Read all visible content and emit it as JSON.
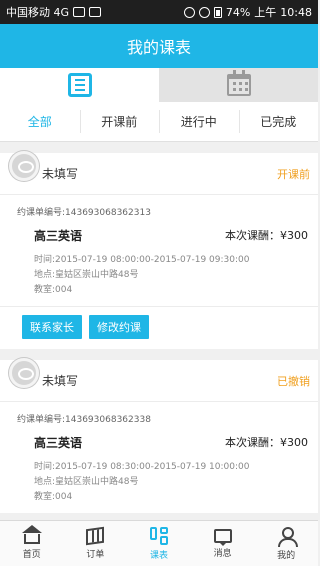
{
  "statusbar": {
    "carrier": "中国移动 4G",
    "battery": "74%",
    "time_prefix": "上午",
    "time": "10:48"
  },
  "header": {
    "title": "我的课表"
  },
  "view_tabs": [
    {
      "name": "list-view",
      "icon": "list-icon",
      "active": true
    },
    {
      "name": "calendar-view",
      "icon": "calendar-icon",
      "active": false
    }
  ],
  "filters": [
    "全部",
    "开课前",
    "进行中",
    "已完成"
  ],
  "orders": [
    {
      "name": "未填写",
      "status": "开课前",
      "order_no": "约课单编号:143693068362313",
      "course": "高三英语",
      "fee": "本次课酬：¥300",
      "time": "时间:2015-07-19 08:00:00-2015-07-19 09:30:00",
      "address": "地点:皇姑区崇山中路48号",
      "room": "教室:004",
      "buttons": [
        "联系家长",
        "修改约课"
      ]
    },
    {
      "name": "未填写",
      "status": "已撤销",
      "order_no": "约课单编号:143693068362338",
      "course": "高三英语",
      "fee": "本次课酬：¥300",
      "time": "时间:2015-07-19 08:30:00-2015-07-19 10:00:00",
      "address": "地点:皇姑区崇山中路48号",
      "room": "教室:004"
    }
  ],
  "bottom_nav": [
    {
      "label": "首页",
      "icon": "home-icon"
    },
    {
      "label": "订单",
      "icon": "map-icon"
    },
    {
      "label": "课表",
      "icon": "schedule-icon"
    },
    {
      "label": "消息",
      "icon": "message-icon"
    },
    {
      "label": "我的",
      "icon": "user-icon"
    }
  ],
  "colors": {
    "accent": "#1fb6e6",
    "status": "#f0a020"
  }
}
